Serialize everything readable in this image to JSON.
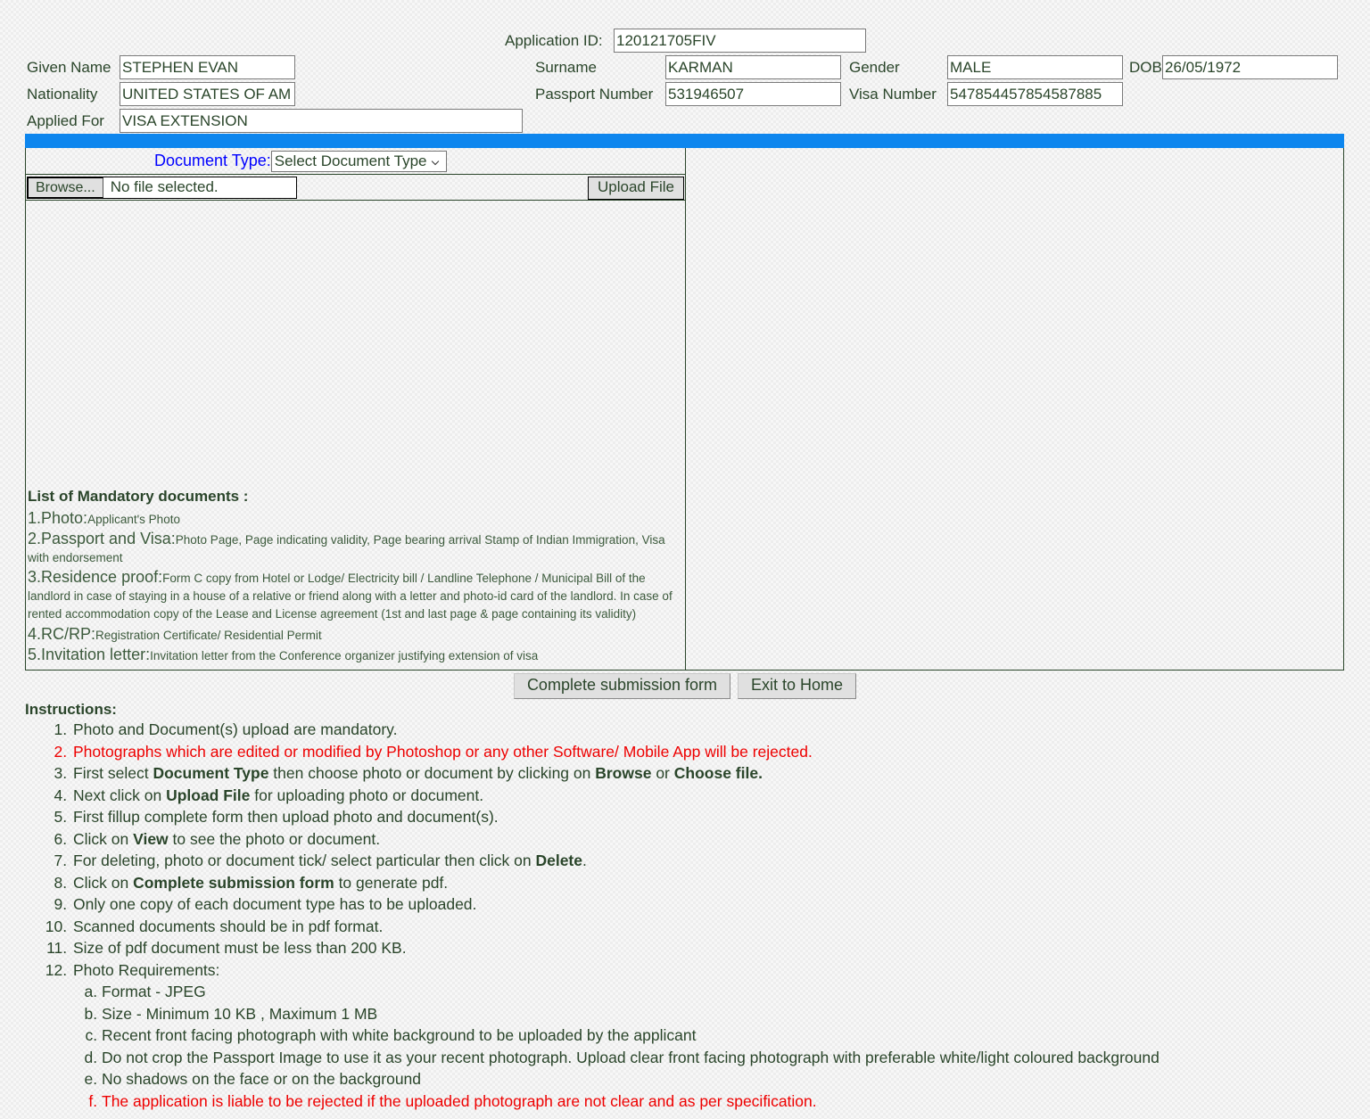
{
  "applicant": {
    "application_id_label": "Application ID:",
    "application_id_value": "120121705FIV",
    "given_name_label": "Given Name",
    "given_name_value": "STEPHEN EVAN",
    "surname_label": "Surname",
    "surname_value": "KARMAN",
    "gender_label": "Gender",
    "gender_value": "MALE",
    "dob_label": "DOB",
    "dob_value": "26/05/1972",
    "nationality_label": "Nationality",
    "nationality_value": "UNITED STATES OF AM",
    "passport_label": "Passport Number",
    "passport_value": "531946507",
    "visa_number_label": "Visa Number",
    "visa_number_value": "547854457854587885",
    "applied_for_label": "Applied For",
    "applied_for_value": "VISA EXTENSION"
  },
  "upload": {
    "document_type_label": "Document Type:",
    "document_type_selected": "Select Document Type",
    "browse_label": "Browse...",
    "file_status": "No file selected.",
    "upload_button_label": "Upload File"
  },
  "mandatory": {
    "heading": "List of Mandatory documents :",
    "items": [
      {
        "head": "1.Photo:",
        "desc": "Applicant's Photo"
      },
      {
        "head": "2.Passport and Visa:",
        "desc": "Photo Page, Page indicating validity, Page bearing arrival Stamp of Indian Immigration, Visa with endorsement"
      },
      {
        "head": "3.Residence proof:",
        "desc": "Form C copy from Hotel or Lodge/ Electricity bill / Landline Telephone / Municipal Bill of the landlord in case of staying in a house of a relative or friend along with a letter and photo-id card of the landlord. In case of rented accommodation copy of the Lease and License agreement (1st and last page & page containing its validity)"
      },
      {
        "head": "4.RC/RP:",
        "desc": "Registration Certificate/ Residential Permit"
      },
      {
        "head": "5.Invitation letter:",
        "desc": "Invitation letter from the Conference organizer justifying extension of visa"
      }
    ]
  },
  "actions": {
    "complete_submission_label": "Complete submission form",
    "exit_home_label": "Exit to Home"
  },
  "instructions": {
    "heading": "Instructions:",
    "items": [
      {
        "text": "Photo and Document(s) upload are mandatory.",
        "color": "normal"
      },
      {
        "text": "Photographs which are edited or modified by Photoshop or any other Software/ Mobile App will be rejected.",
        "color": "red"
      },
      {
        "text": "First select Document Type then choose photo or document by clicking on Browse or Choose file.",
        "color": "normal",
        "bold_parts": [
          "Document Type",
          "Browse",
          "Choose file."
        ]
      },
      {
        "text": "Next click on Upload File for uploading photo or document.",
        "color": "normal",
        "bold_parts": [
          "Upload File"
        ]
      },
      {
        "text": "First fillup complete form then upload photo and document(s).",
        "color": "normal"
      },
      {
        "text": "Click on View to see the photo or document.",
        "color": "normal",
        "bold_parts": [
          "View"
        ]
      },
      {
        "text": "For deleting, photo or document tick/ select particular then click on Delete.",
        "color": "normal",
        "bold_parts": [
          "Delete"
        ]
      },
      {
        "text": "Click on Complete submission form to generate pdf.",
        "color": "normal",
        "bold_parts": [
          "Complete submission form"
        ]
      },
      {
        "text": "Only one copy of each document type has to be uploaded.",
        "color": "normal"
      },
      {
        "text": "Scanned documents should be in pdf format.",
        "color": "normal"
      },
      {
        "text": "Size of pdf document must be less than 200 KB.",
        "color": "normal"
      },
      {
        "text": "Photo Requirements:",
        "color": "normal"
      }
    ],
    "photo_requirements": [
      {
        "text": "Format - JPEG",
        "color": "normal"
      },
      {
        "text": "Size - Minimum 10 KB , Maximum 1 MB",
        "color": "normal"
      },
      {
        "text": "Recent front facing photograph with white background to be uploaded by the applicant",
        "color": "normal"
      },
      {
        "text": "Do not crop the Passport Image to use it as your recent photograph. Upload clear front facing photograph with preferable white/light coloured background",
        "color": "normal"
      },
      {
        "text": "No shadows on the face or on the background",
        "color": "normal"
      },
      {
        "text": "The application is liable to be rejected if the uploaded photograph are not clear and as per specification.",
        "color": "red"
      }
    ]
  },
  "colors": {
    "accent_blue_bar": "#0d86ee",
    "label_blue": "#0000ff",
    "text_green": "#2a452a",
    "warning_red": "#ee0000",
    "page_background": "#ededed"
  }
}
